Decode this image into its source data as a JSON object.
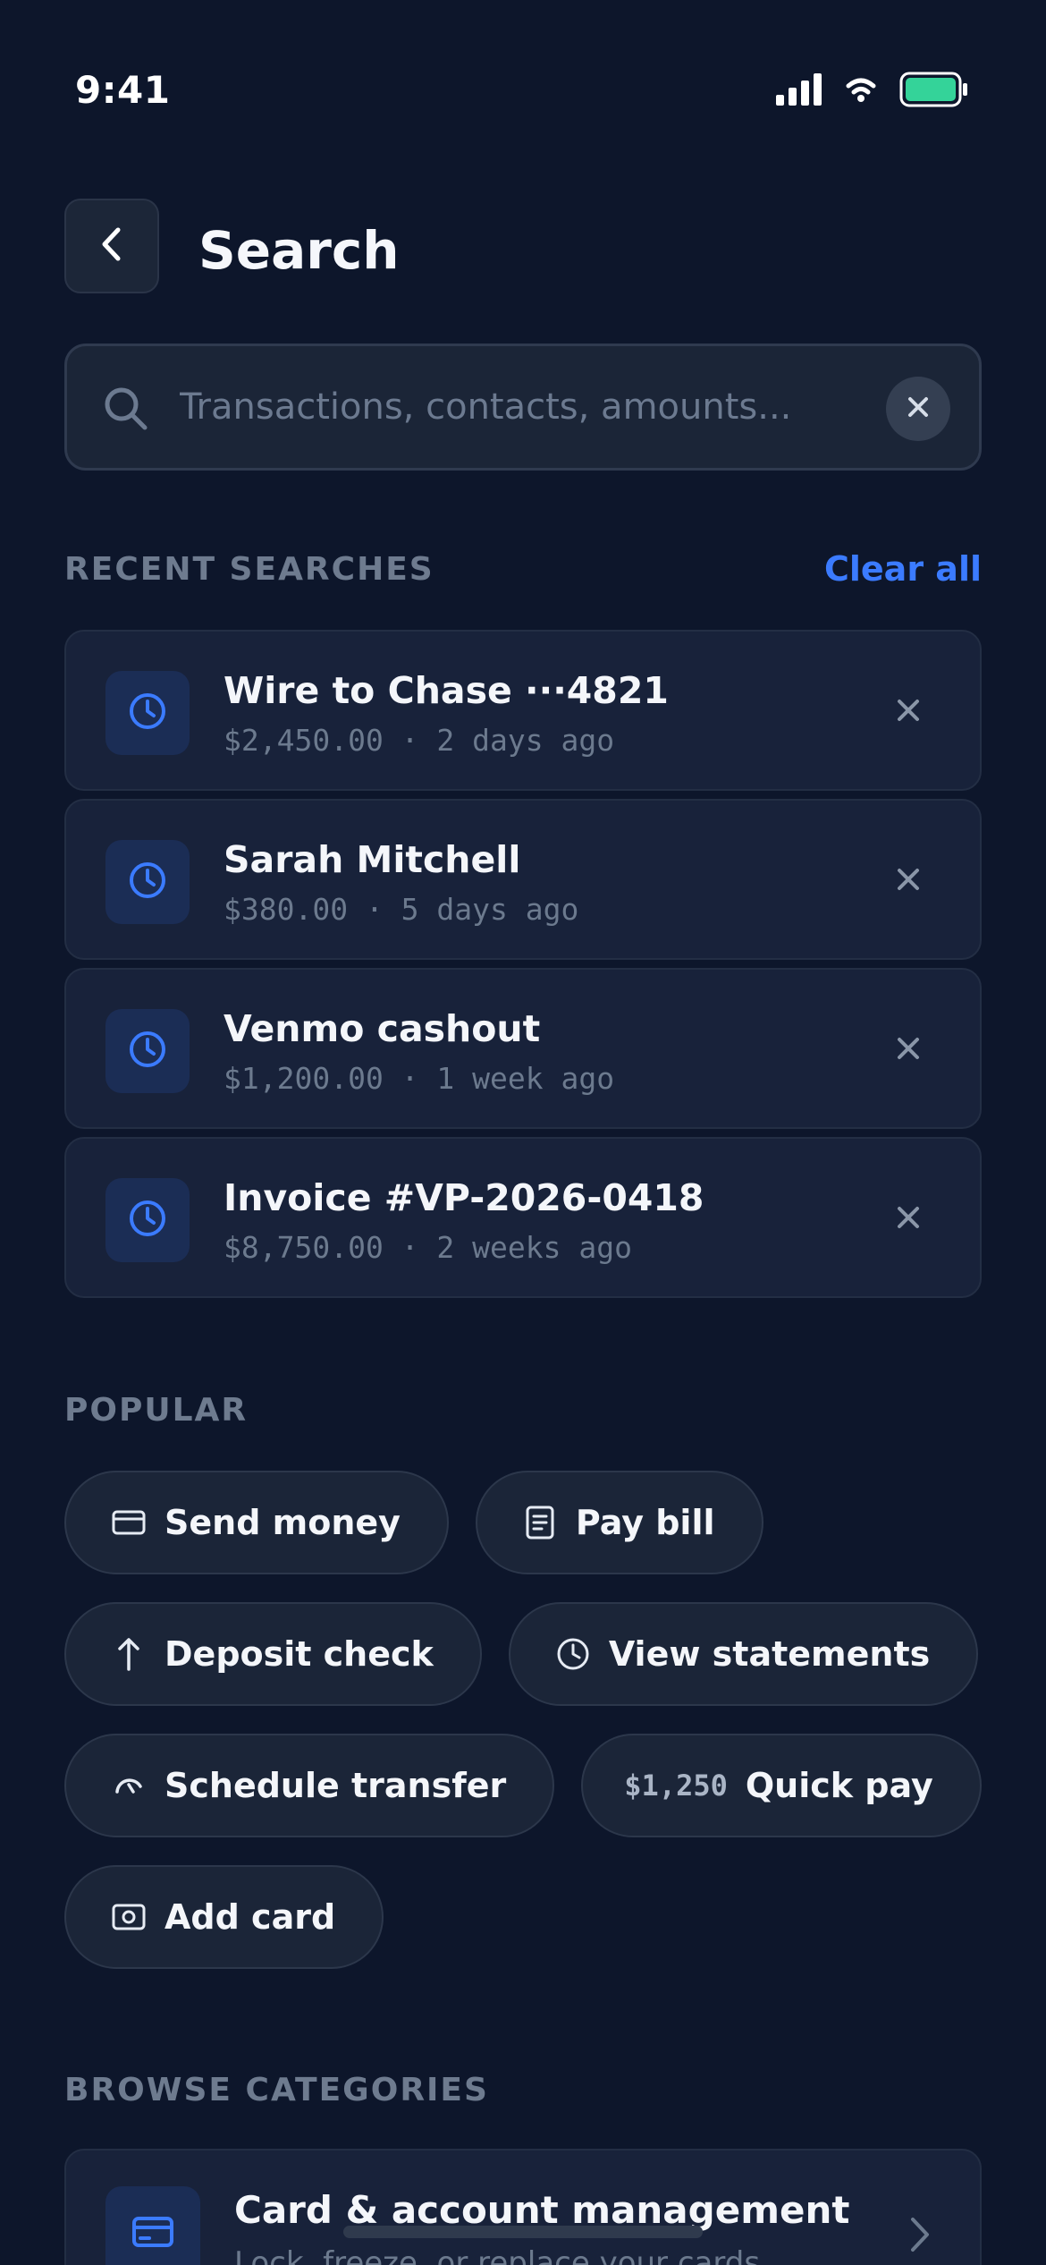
{
  "status_bar": {
    "time": "9:41"
  },
  "header": {
    "title": "Search"
  },
  "search": {
    "placeholder": "Transactions, contacts, amounts...",
    "value": ""
  },
  "recent": {
    "header": "RECENT SEARCHES",
    "clear_all": "Clear all",
    "items": [
      {
        "title": "Wire to Chase ···4821",
        "meta": "$2,450.00 · 2 days ago"
      },
      {
        "title": "Sarah Mitchell",
        "meta": "$380.00 · 5 days ago"
      },
      {
        "title": "Venmo cashout",
        "meta": "$1,200.00 · 1 week ago"
      },
      {
        "title": "Invoice #VP-2026-0418",
        "meta": "$8,750.00 · 2 weeks ago"
      }
    ]
  },
  "popular": {
    "header": "POPULAR",
    "chips": [
      {
        "label": "Send money",
        "icon": "card-icon"
      },
      {
        "label": "Pay bill",
        "icon": "receipt-icon"
      },
      {
        "label": "Deposit check",
        "icon": "arrow-up-icon"
      },
      {
        "label": "View statements",
        "icon": "clock-icon"
      },
      {
        "label": "Schedule transfer",
        "icon": "refresh-icon"
      },
      {
        "label": "Quick pay",
        "amount": "$1,250"
      },
      {
        "label": "Add card",
        "icon": "camera-icon"
      }
    ]
  },
  "categories": {
    "header": "BROWSE CATEGORIES",
    "items": [
      {
        "title": "Card & account management",
        "subtitle": "Lock, freeze, or replace your cards"
      }
    ]
  },
  "colors": {
    "background": "#0d162b",
    "card": "#18223a",
    "accent": "#3b7bff",
    "battery": "#34d399",
    "muted_text": "#6e7b8f"
  }
}
